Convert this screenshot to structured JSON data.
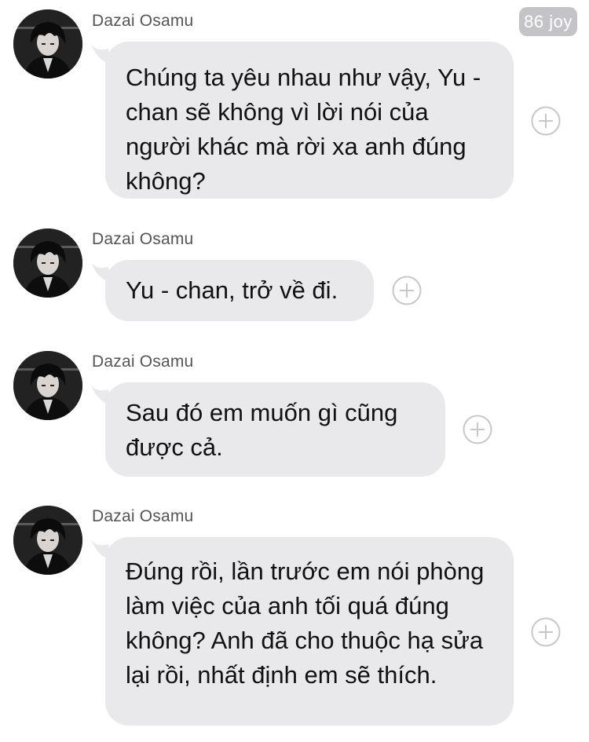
{
  "watermark": "86 joy",
  "messages": [
    {
      "sender": "Dazai Osamu",
      "text": "Chúng ta yêu nhau như vậy, Yu - chan sẽ không vì lời nói của người khác mà rời xa anh đúng không?"
    },
    {
      "sender": "Dazai Osamu",
      "text": "Yu - chan, trở về đi."
    },
    {
      "sender": "Dazai Osamu",
      "text": "Sau đó em muốn gì cũng được cả."
    },
    {
      "sender": "Dazai Osamu",
      "text": "Đúng rồi, lần trước em nói phòng làm việc của anh tối quá đúng không? Anh đã cho thuộc hạ sửa lại rồi, nhất định em sẽ thích."
    }
  ],
  "icons": {
    "reaction": "plus-circle-icon",
    "avatar": "dark-haired-man-avatar"
  },
  "colors": {
    "bubble": "#e9e9eb",
    "text": "#111111",
    "sender": "#555558",
    "icon": "#c7c7cc"
  }
}
